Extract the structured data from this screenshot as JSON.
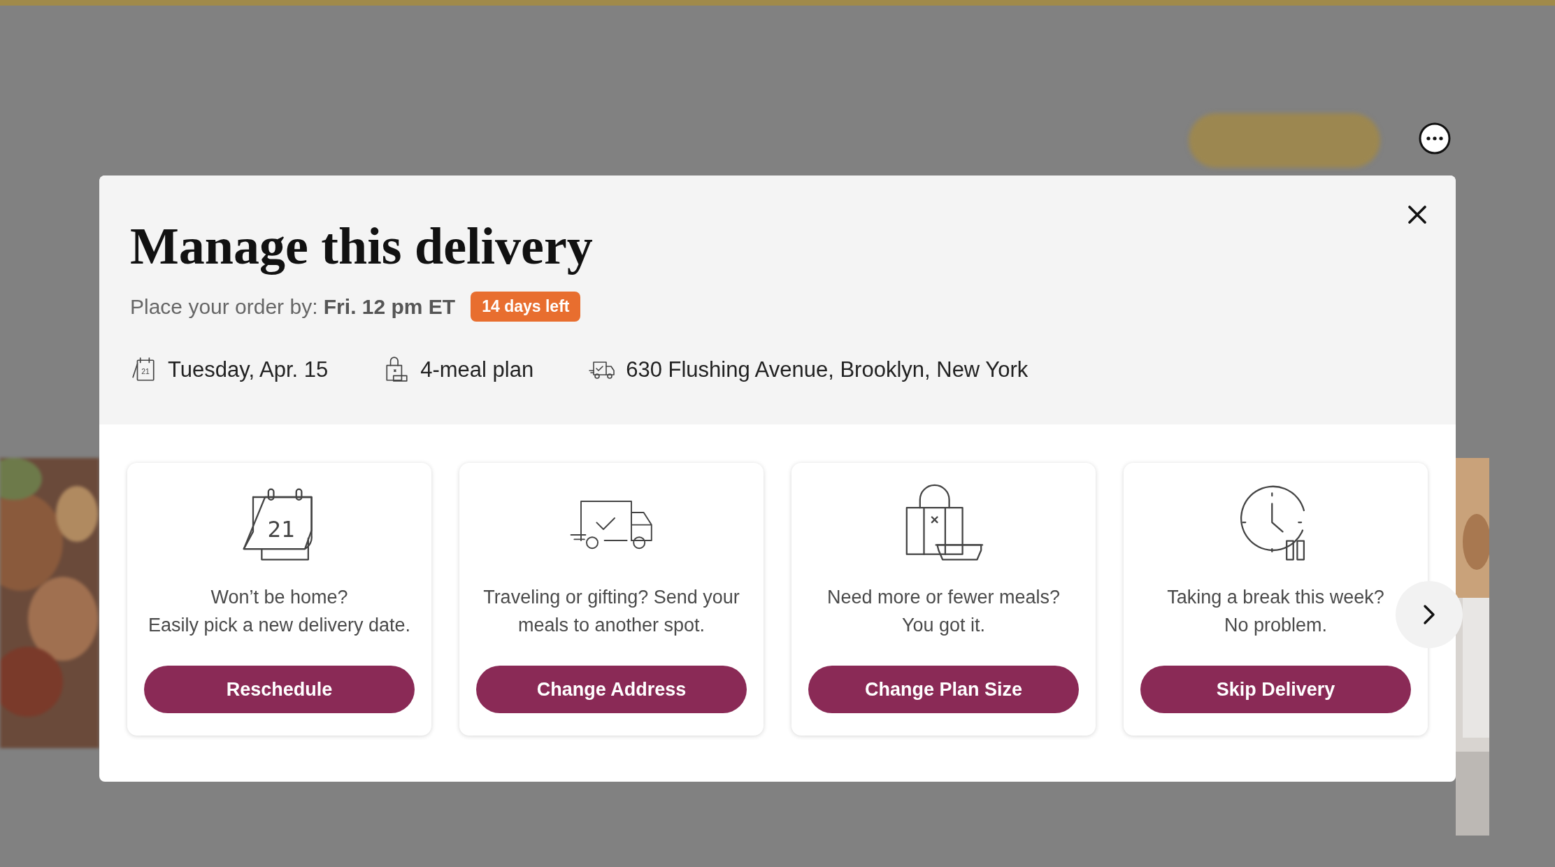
{
  "modal": {
    "title": "Manage this delivery",
    "deadline": {
      "label": "Place your order by:",
      "value": "Fri. 12 pm ET",
      "badge": "14 days left"
    },
    "details": [
      {
        "kind": "date",
        "icon_text": "21",
        "text": "Tuesday, Apr. 15"
      },
      {
        "kind": "plan",
        "text": "4-meal plan"
      },
      {
        "kind": "address",
        "text": "630 Flushing Avenue, Brooklyn, New York"
      }
    ],
    "cards": [
      {
        "kind": "calendar",
        "icon_text": "21",
        "lines": [
          "Won’t be home?",
          "Easily pick a new delivery date."
        ],
        "button": "Reschedule"
      },
      {
        "kind": "truck",
        "lines": [
          "Traveling or gifting? Send your",
          "meals to another spot."
        ],
        "button": "Change Address"
      },
      {
        "kind": "bag",
        "lines": [
          "Need more or fewer meals?",
          "You got it."
        ],
        "button": "Change Plan Size"
      },
      {
        "kind": "clock",
        "lines": [
          "Taking a break this week?",
          "No problem."
        ],
        "button": "Skip Delivery"
      }
    ]
  }
}
